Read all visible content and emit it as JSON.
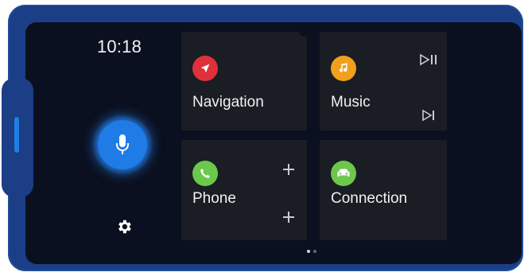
{
  "status": {
    "time": "10:18"
  },
  "assistant": {
    "icon": "microphone-icon",
    "color": "#1f7be6"
  },
  "settings": {
    "icon": "gear-icon"
  },
  "tiles": {
    "navigation": {
      "label": "Navigation",
      "icon": "navigation-arrow-icon",
      "icon_color": "#e0303a"
    },
    "music": {
      "label": "Music",
      "icon": "music-note-icon",
      "icon_color": "#f0a01d",
      "actions": [
        "play-pause-icon",
        "next-track-icon"
      ]
    },
    "phone": {
      "label": "Phone",
      "icon": "phone-icon",
      "icon_color": "#6bc84b",
      "actions": [
        "add-icon",
        "add-icon"
      ]
    },
    "connection": {
      "label": "Connection",
      "icon": "car-icon",
      "icon_color": "#6bc84b"
    }
  },
  "pagination": {
    "pages": 2,
    "current": 1
  }
}
